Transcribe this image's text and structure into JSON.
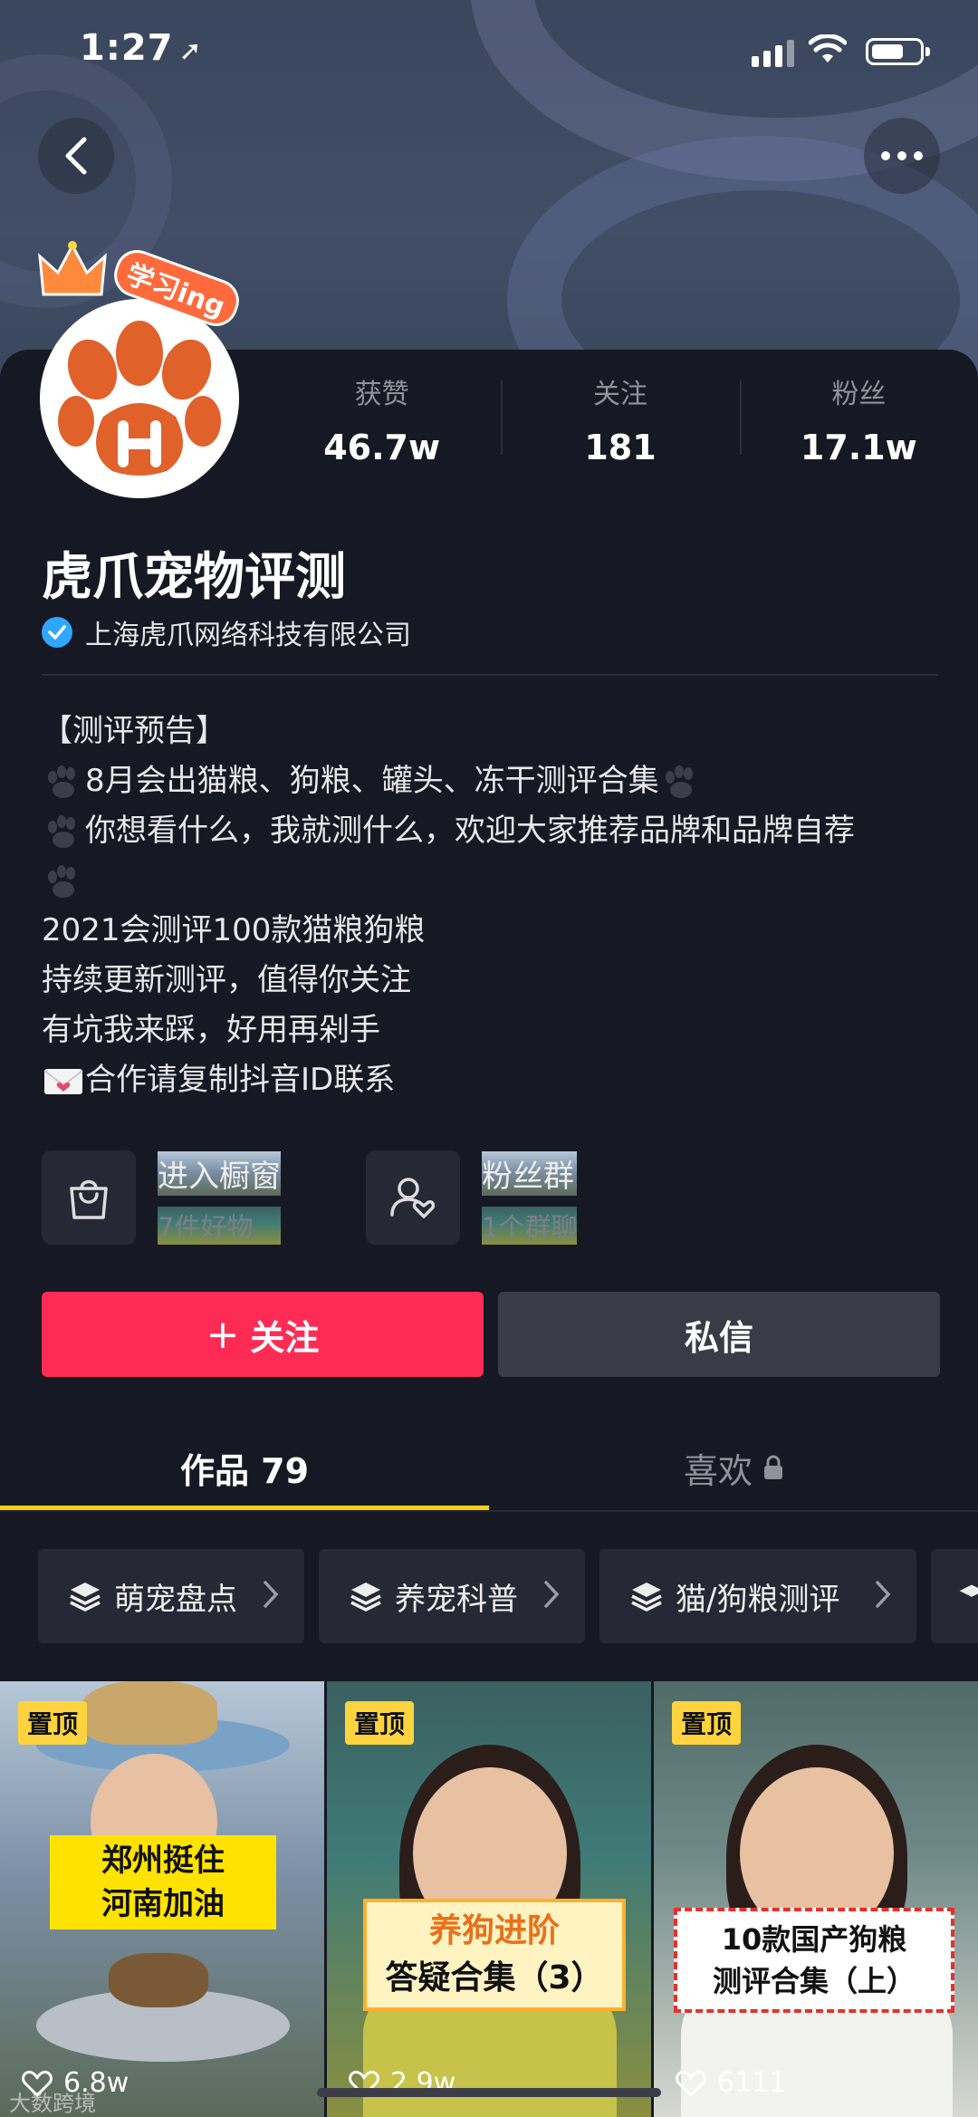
{
  "status_bar": {
    "time": "1:27"
  },
  "profile": {
    "name": "虎爪宠物评测",
    "verified_org": "上海虎爪网络科技有限公司",
    "avatar_badge": "学习ing",
    "stats": [
      {
        "label": "获赞",
        "value": "46.7w"
      },
      {
        "label": "关注",
        "value": "181"
      },
      {
        "label": "粉丝",
        "value": "17.1w"
      }
    ],
    "bio": [
      "【测评预告】",
      "8月会出猫粮、狗粮、罐头、冻干测评合集",
      "你想看什么，我就测什么，欢迎大家推荐品牌和品牌自荐",
      "",
      "2021会测评100款猫粮狗粮",
      "持续更新测评，值得你关注",
      "有坑我来踩，好用再剁手",
      "合作请复制抖音ID联系"
    ]
  },
  "shortcuts": [
    {
      "title": "进入橱窗",
      "subtitle": "7件好物"
    },
    {
      "title": "粉丝群",
      "subtitle": "1个群聊"
    }
  ],
  "actions": {
    "follow": "关注",
    "message": "私信"
  },
  "tabs": {
    "works": "作品 79",
    "likes": "喜欢"
  },
  "collections": [
    "萌宠盘点",
    "养宠科普",
    "猫/狗粮测评"
  ],
  "videos": [
    {
      "pin": "置顶",
      "likes": "6.8w",
      "caption_1": "郑州挺住",
      "caption_2": "河南加油"
    },
    {
      "pin": "置顶",
      "likes": "2.9w",
      "caption_1": "养狗进阶",
      "caption_2": "答疑合集（3）"
    },
    {
      "pin": "置顶",
      "likes": "6111",
      "caption_1": "10款国产狗粮",
      "caption_2": "测评合集（上）"
    }
  ],
  "watermark": "大数跨境",
  "colors": {
    "accent": "#fe2c55",
    "tab_indicator": "#face15",
    "background": "#161823",
    "pin": "#ffd33d",
    "verified": "#2fa6ff"
  }
}
